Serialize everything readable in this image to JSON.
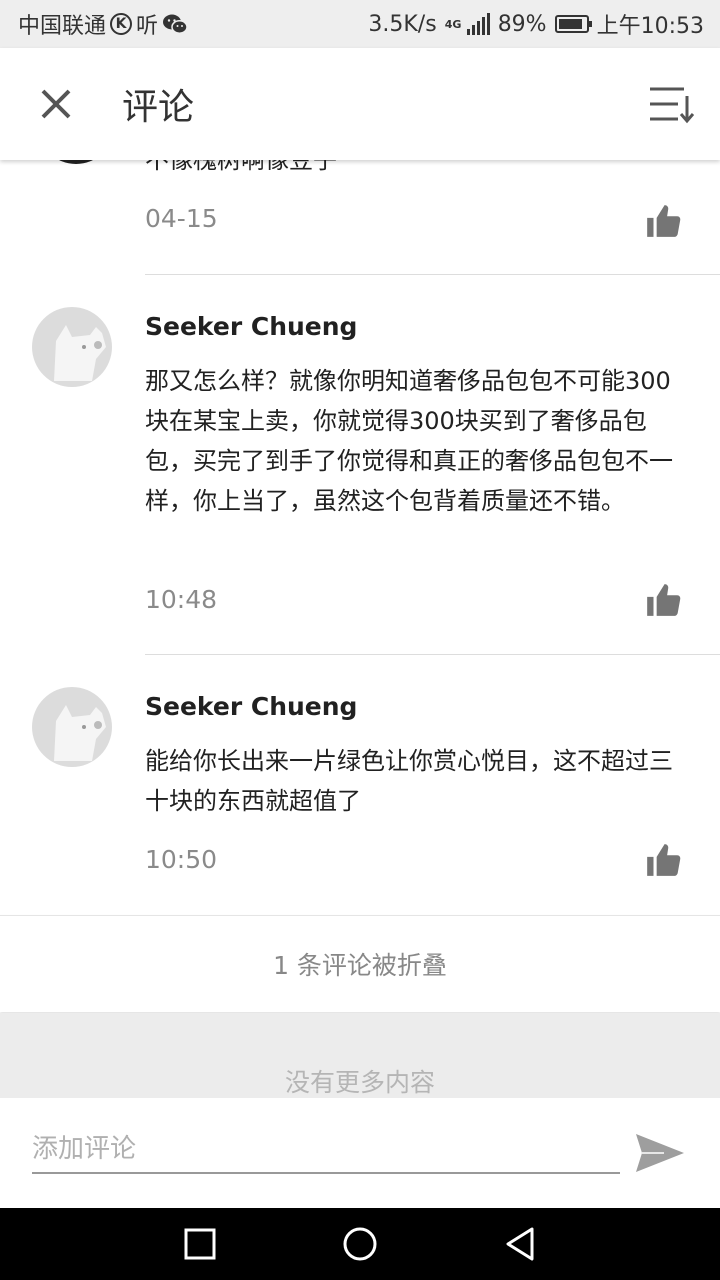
{
  "status_bar": {
    "carrier": "中国联通",
    "k_badge": "K",
    "app_label": "听",
    "speed": "3.5K/s",
    "network": "4G",
    "battery": "89%",
    "battery_level": 0.89,
    "time": "上午10:53"
  },
  "app_bar": {
    "title": "评论",
    "close_icon": "close-icon",
    "sort_icon": "sort-icon"
  },
  "comments": [
    {
      "author": "",
      "text": "不像槐树啊像豆子",
      "time": "04-15",
      "like_icon": "thumbs-up-icon"
    },
    {
      "author": "Seeker Chueng",
      "text": "那又怎么样？就像你明知道奢侈品包包不可能300块在某宝上卖，你就觉得300块买到了奢侈品包包，买完了到手了你觉得和真正的奢侈品包包不一样，你上当了，虽然这个包背着质量还不错。",
      "time": "10:48",
      "like_icon": "thumbs-up-icon"
    },
    {
      "author": "Seeker Chueng",
      "text": "能给你长出来一片绿色让你赏心悦目，这不超过三十块的东西就超值了",
      "time": "10:50",
      "like_icon": "thumbs-up-icon"
    }
  ],
  "folded_notice": "1 条评论被折叠",
  "no_more": "没有更多内容",
  "comment_input": {
    "placeholder": "添加评论",
    "value": ""
  },
  "nav": {
    "recent_icon": "square-icon",
    "home_icon": "circle-icon",
    "back_icon": "triangle-back-icon"
  },
  "colors": {
    "status_bg": "#eeeeee",
    "muted_text": "#8a8a8a",
    "icon_gray": "#757575",
    "nomore_bg": "#ececec"
  }
}
